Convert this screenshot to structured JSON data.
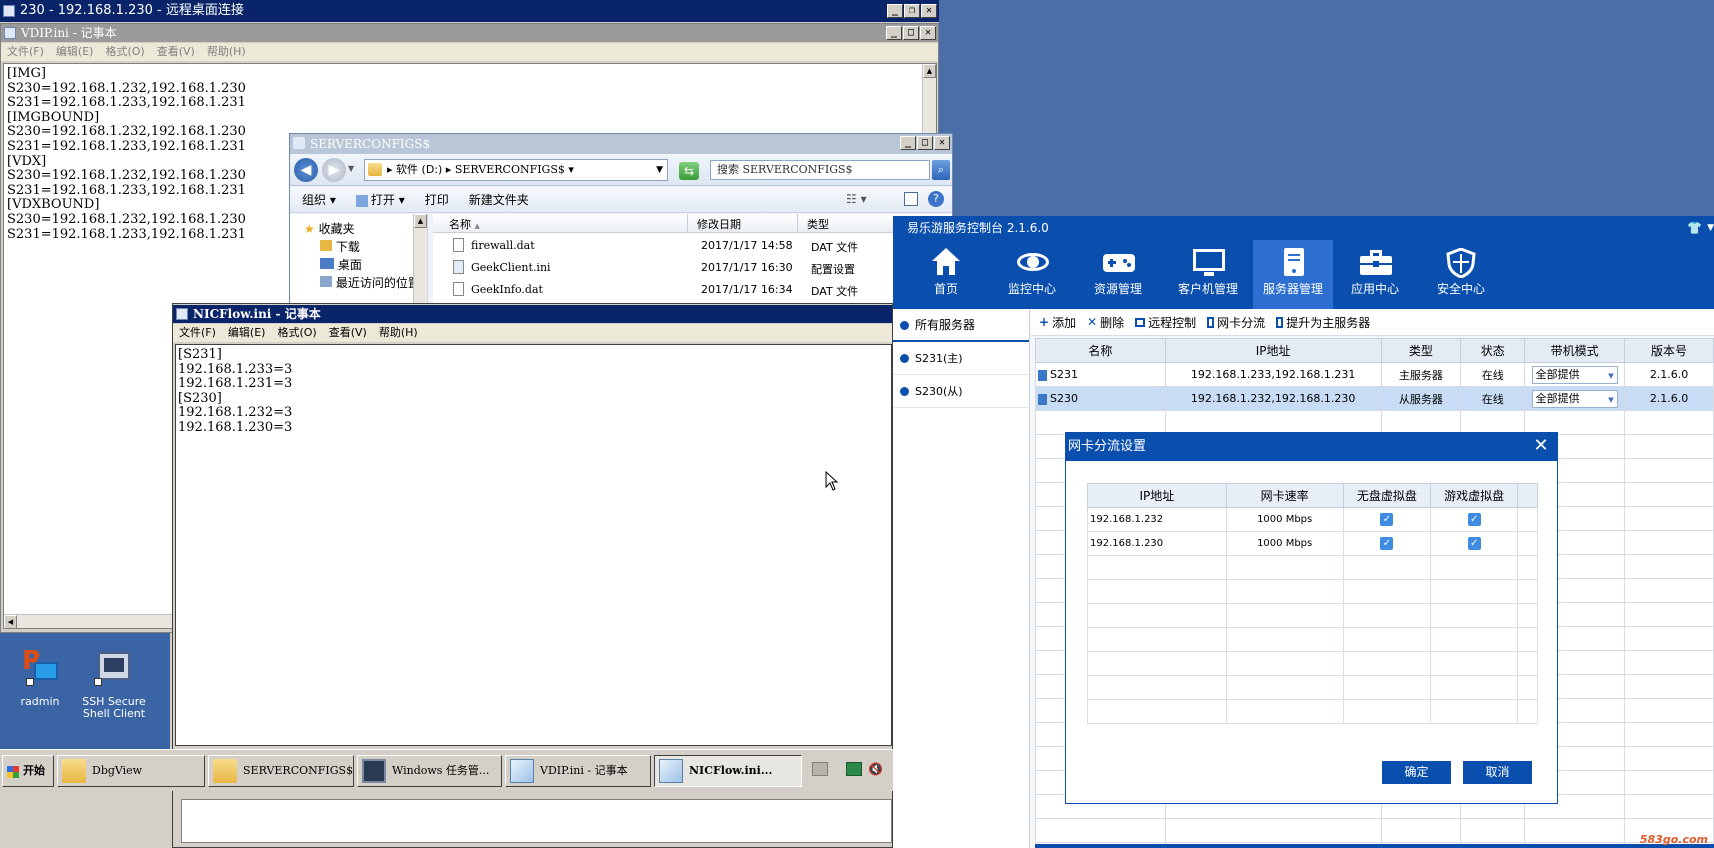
{
  "rdp": {
    "title": "230 - 192.168.1.230 - 远程桌面连接"
  },
  "vdip": {
    "title": "VDIP.ini - 记事本",
    "menu": [
      "文件(F)",
      "编辑(E)",
      "格式(O)",
      "查看(V)",
      "帮助(H)"
    ],
    "lines": [
      "[IMG]",
      "S230=192.168.1.232,192.168.1.230",
      "S231=192.168.1.233,192.168.1.231",
      "[IMGBOUND]",
      "S230=192.168.1.232,192.168.1.230",
      "S231=192.168.1.233,192.168.1.231",
      "[VDX]",
      "S230=192.168.1.232,192.168.1.230",
      "S231=192.168.1.233,192.168.1.231",
      "[VDXBOUND]",
      "S230=192.168.1.232,192.168.1.230",
      "S231=192.168.1.233,192.168.1.231"
    ]
  },
  "explorer": {
    "title": "SERVERCONFIGS$",
    "breadcrumb_drive": "软件 (D:)",
    "breadcrumb_folder": "SERVERCONFIGS$",
    "search_placeholder": "搜索 SERVERCONFIGS$",
    "commands": {
      "organize": "组织",
      "open": "打开",
      "print": "打印",
      "new_folder": "新建文件夹"
    },
    "nav_items": [
      {
        "label": "收藏夹",
        "icon": "star-icon"
      },
      {
        "label": "下载",
        "icon": "download-folder-icon"
      },
      {
        "label": "桌面",
        "icon": "desktop-icon"
      },
      {
        "label": "最近访问的位置",
        "icon": "recent-places-icon"
      }
    ],
    "columns": {
      "name": "名称",
      "modified": "修改日期",
      "type": "类型"
    },
    "files": [
      {
        "name": "firewall.dat",
        "modified": "2017/1/17 14:58",
        "type": "DAT 文件"
      },
      {
        "name": "GeekClient.ini",
        "modified": "2017/1/17 16:30",
        "type": "配置设置"
      },
      {
        "name": "GeekInfo.dat",
        "modified": "2017/1/17 16:34",
        "type": "DAT 文件"
      }
    ]
  },
  "nicflow": {
    "title": "NICFlow.ini - 记事本",
    "menu": [
      "文件(F)",
      "编辑(E)",
      "格式(O)",
      "查看(V)",
      "帮助(H)"
    ],
    "lines": [
      "[S231]",
      "192.168.1.233=3",
      "192.168.1.231=3",
      "[S230]",
      "192.168.1.232=3",
      "192.168.1.230=3"
    ]
  },
  "desktop": {
    "icons": [
      {
        "label": "radmin",
        "icon": "radmin-icon"
      },
      {
        "label": "SSH Secure Shell Client",
        "icon": "ssh-client-icon"
      }
    ]
  },
  "taskbar": {
    "start": "开始",
    "buttons": [
      {
        "label": "DbgView",
        "icon": "folder-icon"
      },
      {
        "label": "SERVERCONFIGS$",
        "icon": "folder-icon"
      },
      {
        "label": "Windows 任务管...",
        "icon": "task-manager-icon"
      },
      {
        "label": "VDIP.ini - 记事本",
        "icon": "notepad-icon"
      },
      {
        "label": "NICFlow.ini...",
        "icon": "notepad-icon"
      }
    ]
  },
  "console": {
    "title": "易乐游服务控制台 2.1.6.0",
    "nav": [
      {
        "label": "首页",
        "icon": "home-icon"
      },
      {
        "label": "监控中心",
        "icon": "eye-icon"
      },
      {
        "label": "资源管理",
        "icon": "gamepad-icon"
      },
      {
        "label": "客户机管理",
        "icon": "monitor-icon"
      },
      {
        "label": "服务器管理",
        "icon": "server-icon"
      },
      {
        "label": "应用中心",
        "icon": "toolbox-icon"
      },
      {
        "label": "安全中心",
        "icon": "shield-icon"
      }
    ],
    "active_nav": "服务器管理",
    "sidebar": {
      "all": "所有服务器",
      "items": [
        "S231(主)",
        "S230(从)"
      ]
    },
    "toolbar": {
      "add": "添加",
      "delete": "删除",
      "remote": "远程控制",
      "nic": "网卡分流",
      "promote": "提升为主服务器"
    },
    "columns": {
      "name": "名称",
      "ip": "IP地址",
      "type": "类型",
      "status": "状态",
      "bandwidth": "带机模式",
      "version": "版本号"
    },
    "rows": [
      {
        "name": "S231",
        "ip": "192.168.1.233,192.168.1.231",
        "type": "主服务器",
        "status": "在线",
        "bandwidth": "全部提供",
        "version": "2.1.6.0"
      },
      {
        "name": "S230",
        "ip": "192.168.1.232,192.168.1.230",
        "type": "从服务器",
        "status": "在线",
        "bandwidth": "全部提供",
        "version": "2.1.6.0"
      }
    ]
  },
  "dialog": {
    "title": "网卡分流设置",
    "columns": {
      "ip": "IP地址",
      "speed": "网卡速率",
      "diskless": "无盘虚拟盘",
      "game": "游戏虚拟盘"
    },
    "rows": [
      {
        "ip": "192.168.1.232",
        "speed": "1000 Mbps",
        "diskless": true,
        "game": true
      },
      {
        "ip": "192.168.1.230",
        "speed": "1000 Mbps",
        "diskless": true,
        "game": true
      }
    ],
    "ok": "确定",
    "cancel": "取消"
  },
  "watermark": "583go.com",
  "colors": {
    "console_blue": "#0a4fae",
    "nav_active": "#2c6fd0",
    "selected_row": "#c8dcf5",
    "desktop": "#4a6ea8"
  }
}
